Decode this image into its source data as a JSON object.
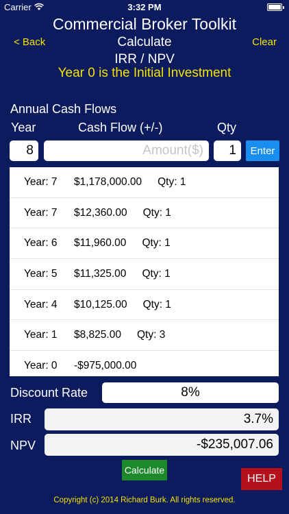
{
  "status_bar": {
    "carrier": "Carrier",
    "time": "3:32 PM"
  },
  "header": {
    "app_title": "Commercial Broker Toolkit",
    "back_label": "< Back",
    "nav_title": "Calculate",
    "clear_label": "Clear",
    "sub_title": "IRR / NPV",
    "notice": "Year 0 is the Initial Investment"
  },
  "cash_flows": {
    "section_label": "Annual Cash Flows",
    "col_year": "Year",
    "col_flow": "Cash Flow (+/-)",
    "col_qty": "Qty",
    "year_value": "8",
    "amount_placeholder": "Amount($)",
    "qty_value": "1",
    "enter_label": "Enter",
    "rows": [
      {
        "year": "Year: 7",
        "amount": "$1,178,000.00",
        "qty": "Qty: 1"
      },
      {
        "year": "Year: 7",
        "amount": "$12,360.00",
        "qty": "Qty: 1"
      },
      {
        "year": "Year: 6",
        "amount": "$11,960.00",
        "qty": "Qty: 1"
      },
      {
        "year": "Year: 5",
        "amount": "$11,325.00",
        "qty": "Qty: 1"
      },
      {
        "year": "Year: 4",
        "amount": "$10,125.00",
        "qty": "Qty: 1"
      },
      {
        "year": "Year: 1",
        "amount": "$8,825.00",
        "qty": "Qty: 3"
      },
      {
        "year": "Year: 0",
        "amount": "-$975,000.00",
        "qty": ""
      }
    ]
  },
  "results": {
    "discount_label": "Discount Rate",
    "discount_value": "8%",
    "irr_label": "IRR",
    "irr_value": "3.7%",
    "npv_label": "NPV",
    "npv_value": "-$235,007.06"
  },
  "footer": {
    "calculate_label": "Calculate",
    "help_label": "HELP",
    "copyright": "Copyright (c) 2014 Richard Burk. All rights reserved."
  },
  "colors": {
    "background": "#0c1a5e",
    "accent_yellow": "#f5e400",
    "enter_blue": "#1a8ef0",
    "calculate_green": "#1c8a2a",
    "help_red": "#b5101c"
  }
}
